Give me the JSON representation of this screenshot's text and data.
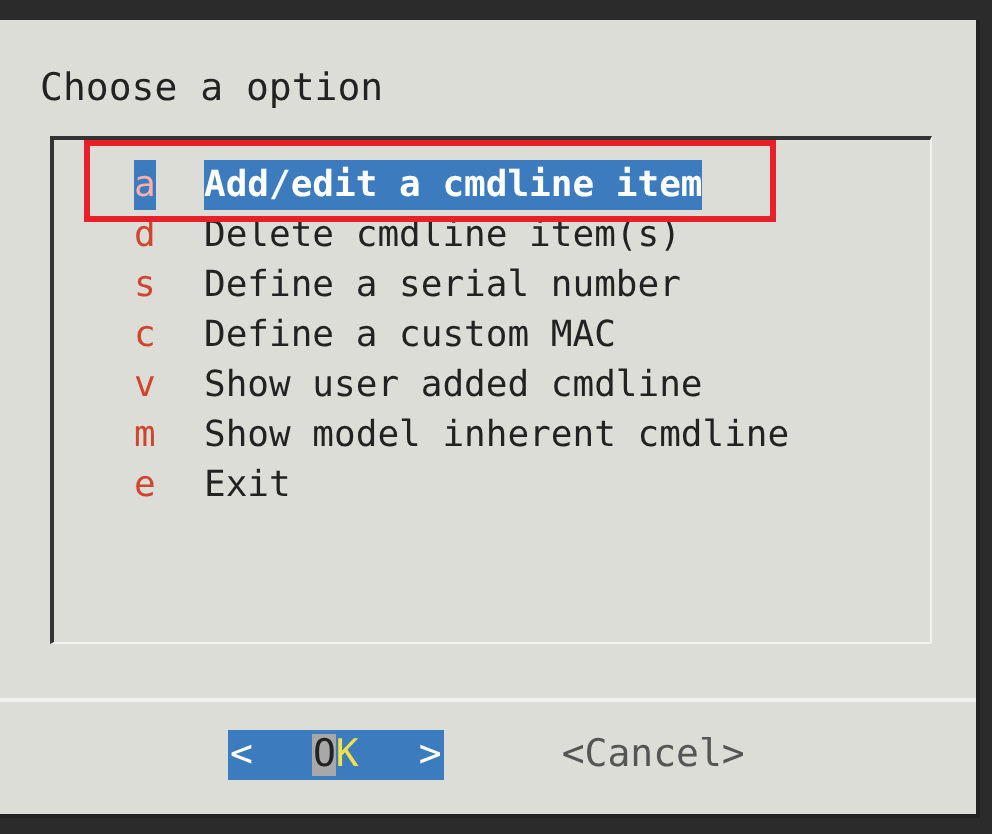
{
  "dialog": {
    "title": "Choose a option"
  },
  "menu": [
    {
      "key": "a",
      "label": "Add/edit a cmdline item",
      "selected": true
    },
    {
      "key": "d",
      "label": "Delete cmdline item(s)",
      "selected": false
    },
    {
      "key": "s",
      "label": "Define a serial number",
      "selected": false
    },
    {
      "key": "c",
      "label": "Define a custom MAC",
      "selected": false
    },
    {
      "key": "v",
      "label": "Show user added cmdline",
      "selected": false
    },
    {
      "key": "m",
      "label": "Show model inherent cmdline",
      "selected": false
    },
    {
      "key": "e",
      "label": "Exit",
      "selected": false
    }
  ],
  "buttons": [
    {
      "open": "<",
      "label": "OK",
      "close": ">",
      "selected": true
    },
    {
      "open": "<",
      "label": "Cancel",
      "close": ">",
      "selected": false
    }
  ]
}
